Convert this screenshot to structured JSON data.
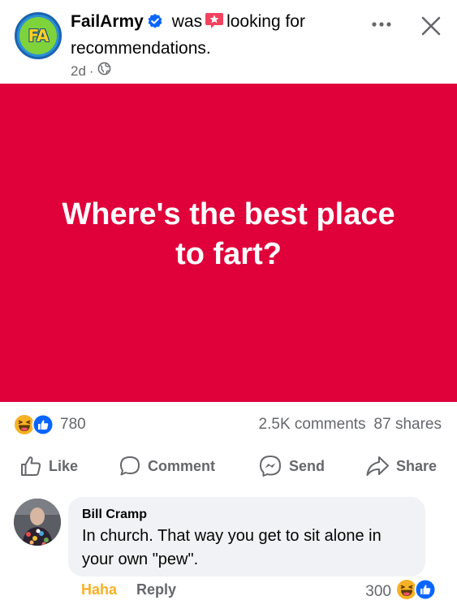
{
  "post_header": {
    "page_avatar_text": "FA",
    "page_name": "FailArmy",
    "status_before": "was",
    "status_after": "looking for recommendations.",
    "timestamp": "2d",
    "separator": "·",
    "privacy": "globe-icon"
  },
  "post": {
    "banner_text": "Where's the best place to fart?",
    "banner_color": "#e0003a"
  },
  "stats": {
    "reactions": [
      "haha",
      "like"
    ],
    "reaction_count": "780",
    "comments": "2.5K comments",
    "shares": "87 shares"
  },
  "actions": {
    "like": "Like",
    "comment": "Comment",
    "send": "Send",
    "share": "Share"
  },
  "comment": {
    "author": "Bill Cramp",
    "text": "In church. That way you get to sit alone in your own \"pew\".",
    "haha_label": "Haha",
    "reply_label": "Reply",
    "reaction_count": "300",
    "reactions": [
      "haha",
      "like"
    ]
  },
  "colors": {
    "accent_blue": "#0866ff",
    "haha_yellow": "#f7b125",
    "secondary_text": "#65676b",
    "bubble_bg": "#f0f2f5"
  }
}
